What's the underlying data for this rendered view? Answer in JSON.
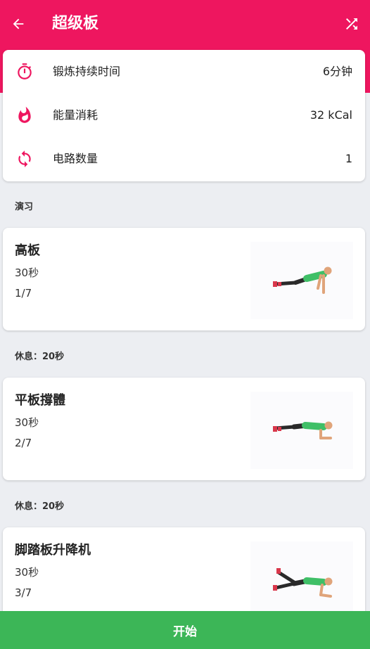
{
  "header": {
    "title": "超级板",
    "back_icon": "arrow-left-icon",
    "shuffle_icon": "shuffle-icon",
    "color": "#ee165f"
  },
  "summary": [
    {
      "icon": "stopwatch-icon",
      "label": "锻炼持续时间",
      "value": "6分钟"
    },
    {
      "icon": "flame-icon",
      "label": "能量消耗",
      "value": "32 kCal"
    },
    {
      "icon": "repeat-icon",
      "label": "电路数量",
      "value": "1"
    }
  ],
  "exercises_heading": "演习",
  "exercises": [
    {
      "name": "高板",
      "duration": "30秒",
      "index": "1/7"
    },
    {
      "name": "平板撐體",
      "duration": "30秒",
      "index": "2/7"
    },
    {
      "name": "脚踏板升降机",
      "duration": "30秒",
      "index": "3/7"
    }
  ],
  "rest": {
    "label": "休息：",
    "value": "20秒"
  },
  "start_button": {
    "label": "开始",
    "color": "#3cb657"
  }
}
